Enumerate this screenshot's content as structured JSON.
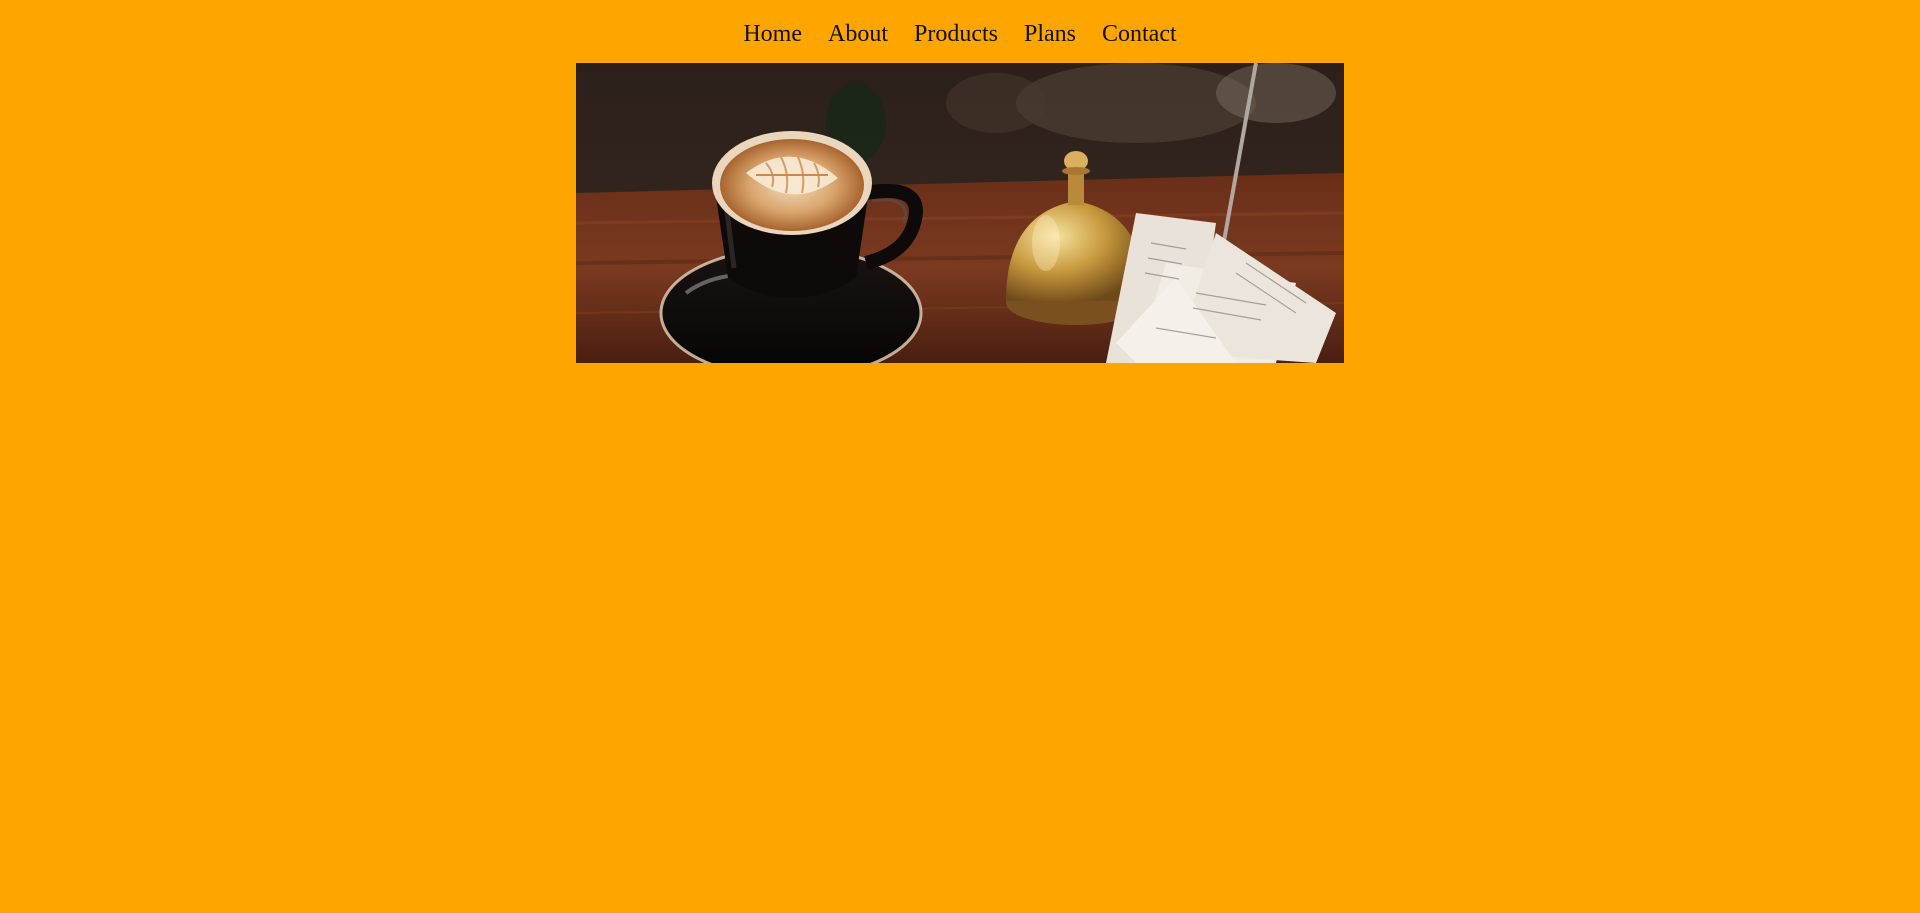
{
  "nav": {
    "items": [
      {
        "label": "Home"
      },
      {
        "label": "About"
      },
      {
        "label": "Products"
      },
      {
        "label": "Plans"
      },
      {
        "label": "Contact"
      }
    ]
  },
  "hero": {
    "image": "coffee-latte-with-bell-and-receipts-photo"
  },
  "colors": {
    "background": "#FFA500",
    "nav_text": "#111111"
  }
}
